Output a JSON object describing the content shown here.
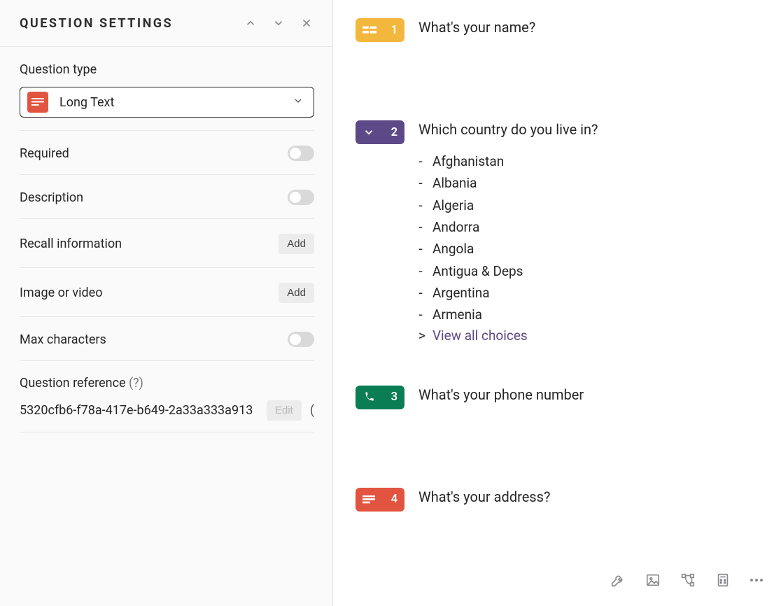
{
  "settings": {
    "panel_title": "QUESTION SETTINGS",
    "type_label": "Question type",
    "type_value": "Long Text",
    "required_label": "Required",
    "description_label": "Description",
    "recall_label": "Recall information",
    "media_label": "Image or video",
    "maxchars_label": "Max characters",
    "add_button": "Add",
    "ref_label_main": "Question reference",
    "ref_label_hint": "(?)",
    "ref_value": "5320cfb6-f78a-417e-b649-2a33a333a913",
    "edit_button": "Edit",
    "paren_tail": "("
  },
  "questions": [
    {
      "num": "1",
      "badge": "yellow",
      "icon": "short-text-icon",
      "text": "What's your name?"
    },
    {
      "num": "2",
      "badge": "purple",
      "icon": "dropdown-icon",
      "text": "Which country do you live in?",
      "choices": [
        "Afghanistan",
        "Albania",
        "Algeria",
        "Andorra",
        "Angola",
        "Antigua & Deps",
        "Argentina",
        "Armenia"
      ],
      "view_all": "View all choices"
    },
    {
      "num": "3",
      "badge": "green",
      "icon": "phone-icon",
      "text": "What's your phone number"
    },
    {
      "num": "4",
      "badge": "red",
      "icon": "long-text-icon",
      "text": "What's your address?"
    }
  ]
}
